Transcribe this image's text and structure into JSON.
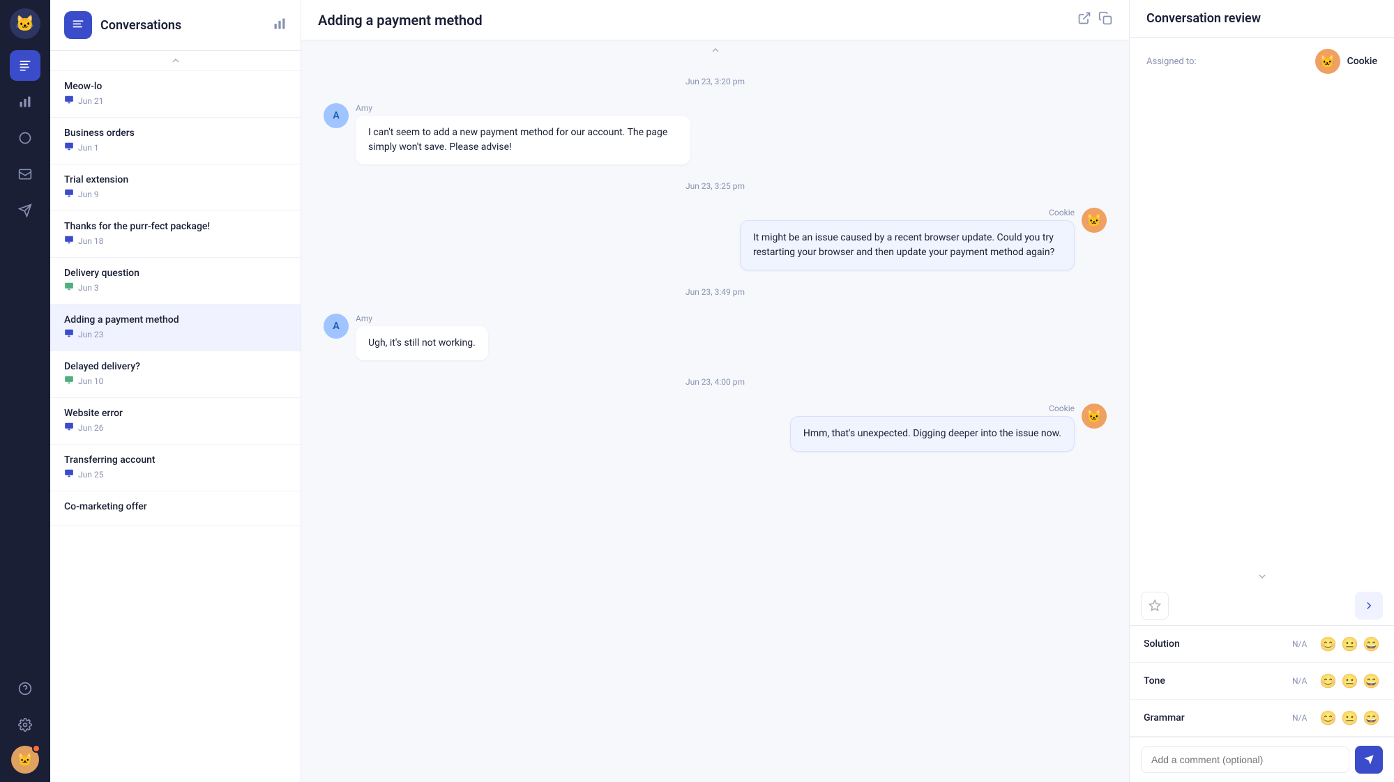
{
  "leftNav": {
    "logo": "🐱",
    "icons": [
      {
        "name": "conversations-icon",
        "symbol": "≡",
        "active": false
      },
      {
        "name": "analytics-icon",
        "symbol": "📊",
        "active": false
      },
      {
        "name": "contacts-icon",
        "symbol": "○",
        "active": false
      },
      {
        "name": "inbox-icon",
        "symbol": "✉",
        "active": false
      },
      {
        "name": "send-icon",
        "symbol": "➤",
        "active": false
      }
    ],
    "bottomIcons": [
      {
        "name": "help-icon",
        "symbol": "?"
      },
      {
        "name": "settings-icon",
        "symbol": "⚙"
      }
    ],
    "avatar": "🐱"
  },
  "sidebar": {
    "title": "Conversations",
    "icon": "≡",
    "items": [
      {
        "id": "meow-lo",
        "title": "Meow-lo",
        "date": "Jun 21",
        "iconType": "zendesk"
      },
      {
        "id": "business-orders",
        "title": "Business orders",
        "date": "Jun 1",
        "iconType": "zendesk"
      },
      {
        "id": "trial-extension",
        "title": "Trial extension",
        "date": "Jun 9",
        "iconType": "zendesk"
      },
      {
        "id": "thanks-purr-fect",
        "title": "Thanks for the purr-fect package!",
        "date": "Jun 18",
        "iconType": "zendesk"
      },
      {
        "id": "delivery-question",
        "title": "Delivery question",
        "date": "Jun 3",
        "iconType": "freshdesk"
      },
      {
        "id": "adding-payment",
        "title": "Adding a payment method",
        "date": "Jun 23",
        "iconType": "zendesk",
        "active": true
      },
      {
        "id": "delayed-delivery",
        "title": "Delayed delivery?",
        "date": "Jun 10",
        "iconType": "freshdesk"
      },
      {
        "id": "website-error",
        "title": "Website error",
        "date": "Jun 26",
        "iconType": "zendesk"
      },
      {
        "id": "transferring-account",
        "title": "Transferring account",
        "date": "Jun 25",
        "iconType": "zendesk"
      },
      {
        "id": "co-marketing",
        "title": "Co-marketing offer",
        "date": "",
        "iconType": ""
      }
    ]
  },
  "chat": {
    "title": "Adding a payment method",
    "messages": [
      {
        "id": "msg1",
        "timestamp": "Jun 23, 3:20 pm",
        "sender": "Amy",
        "senderType": "customer",
        "text": "I can't seem to add a new payment method for our account. The page simply won't save. Please advise!"
      },
      {
        "id": "msg2",
        "timestamp": "Jun 23, 3:25 pm",
        "sender": "Cookie",
        "senderType": "agent",
        "text": "It might be an issue caused by a recent browser update. Could you try restarting your browser and then update your payment method again?"
      },
      {
        "id": "msg3",
        "timestamp": "Jun 23, 3:49 pm",
        "sender": "Amy",
        "senderType": "customer",
        "text": "Ugh, it's still not working."
      },
      {
        "id": "msg4",
        "timestamp": "Jun 23, 4:00 pm",
        "sender": "Cookie",
        "senderType": "agent",
        "text": "Hmm, that's unexpected. Digging deeper into the issue now."
      }
    ]
  },
  "rightPanel": {
    "title": "Conversation review",
    "assignedLabel": "Assigned to:",
    "assigneeName": "Cookie",
    "reviewRows": [
      {
        "id": "solution",
        "label": "Solution",
        "naText": "N/A",
        "emojis": [
          "😊",
          "😐",
          "😄"
        ]
      },
      {
        "id": "tone",
        "label": "Tone",
        "naText": "N/A",
        "emojis": [
          "😊",
          "😐",
          "😄"
        ]
      },
      {
        "id": "grammar",
        "label": "Grammar",
        "naText": "N/A",
        "emojis": [
          "😊",
          "😐",
          "😄"
        ]
      }
    ],
    "commentPlaceholder": "Add a comment (optional)"
  }
}
